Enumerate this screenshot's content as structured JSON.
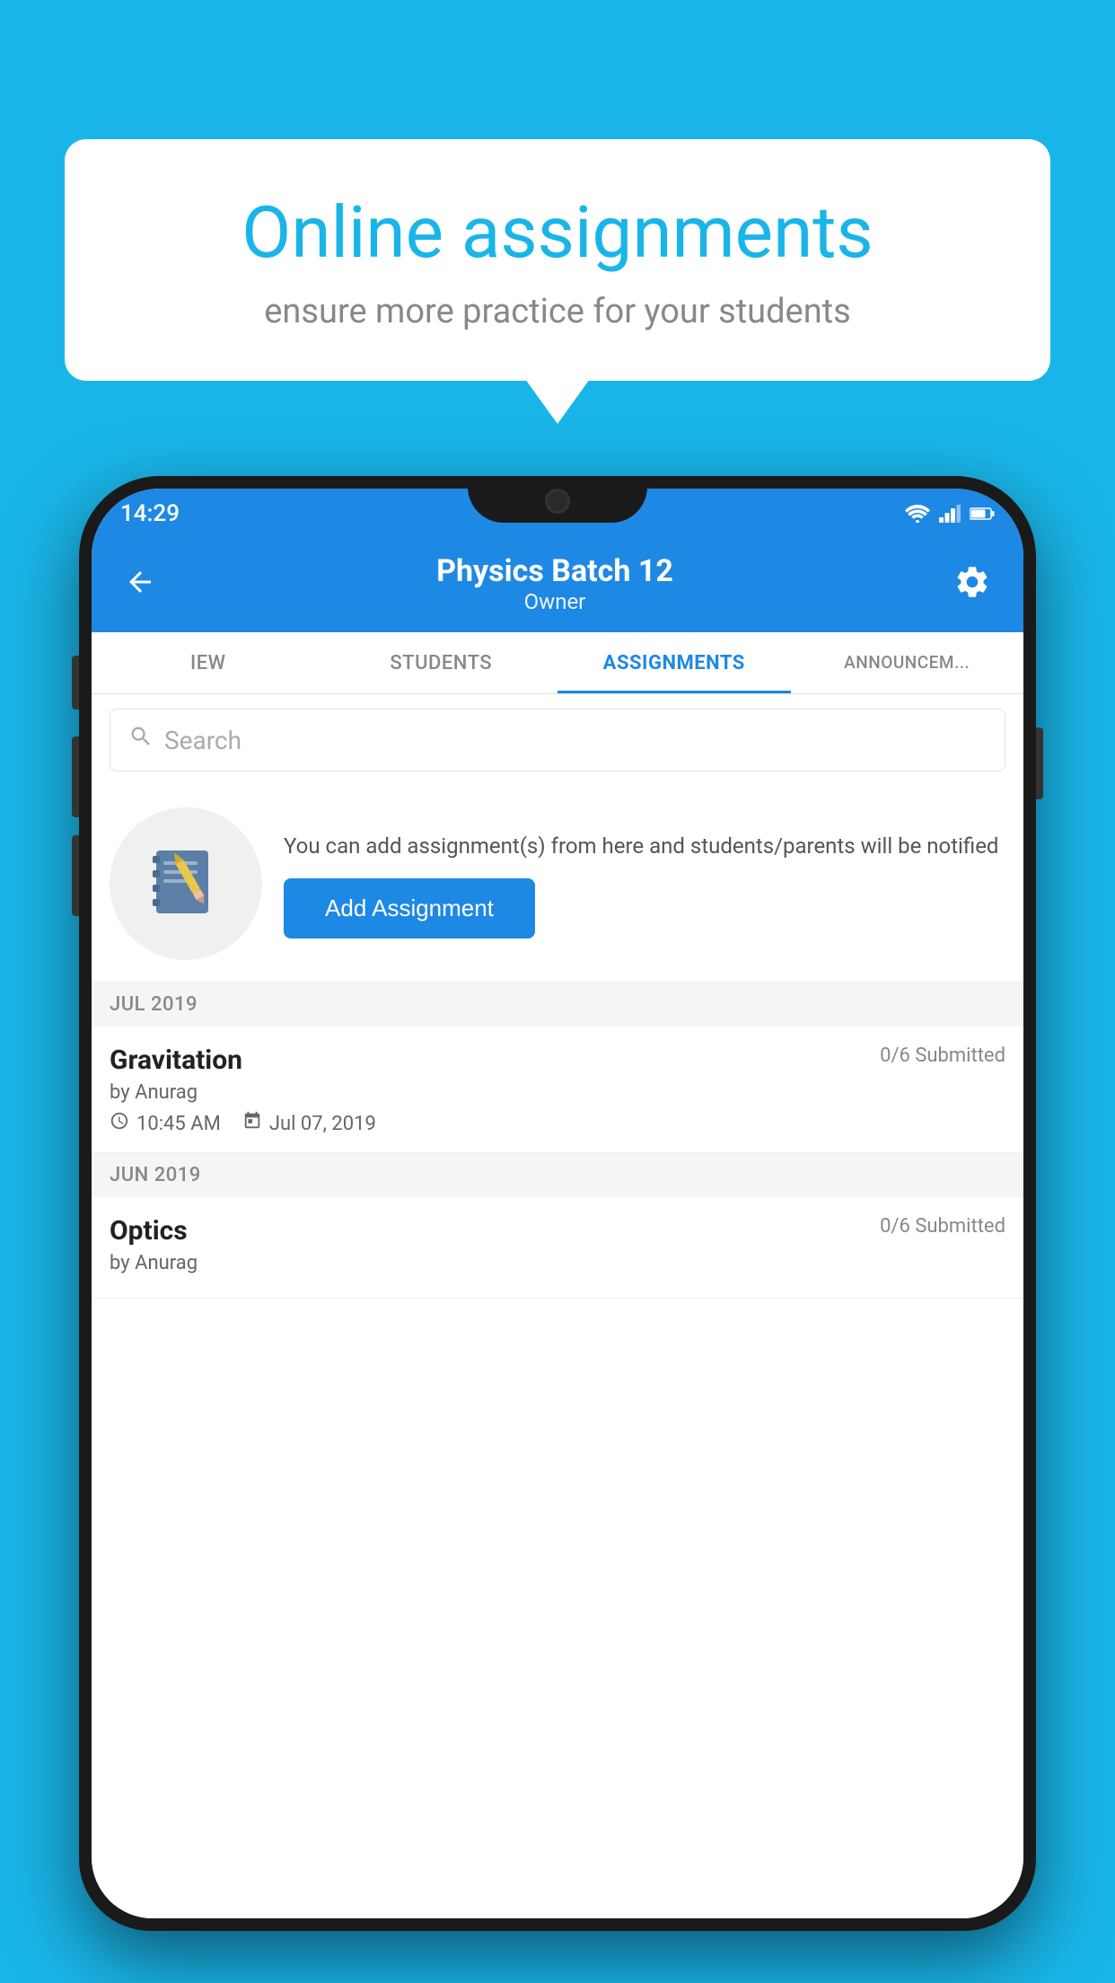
{
  "background_color": "#1ab5e8",
  "speech_bubble": {
    "title": "Online assignments",
    "subtitle": "ensure more practice for your students"
  },
  "phone": {
    "status_bar": {
      "time": "14:29",
      "icons": [
        "wifi",
        "signal",
        "battery"
      ]
    },
    "header": {
      "title": "Physics Batch 12",
      "subtitle": "Owner",
      "back_label": "←",
      "settings_label": "⚙"
    },
    "tabs": [
      {
        "label": "IEW",
        "active": false
      },
      {
        "label": "STUDENTS",
        "active": false
      },
      {
        "label": "ASSIGNMENTS",
        "active": true
      },
      {
        "label": "ANNOUNCEM...",
        "active": false
      }
    ],
    "search": {
      "placeholder": "Search"
    },
    "promo": {
      "text": "You can add assignment(s) from here and students/parents will be notified",
      "button_label": "Add Assignment"
    },
    "assignments": [
      {
        "month_group": "JUL 2019",
        "name": "Gravitation",
        "submitted": "0/6 Submitted",
        "by": "by Anurag",
        "time": "10:45 AM",
        "date": "Jul 07, 2019"
      },
      {
        "month_group": "JUN 2019",
        "name": "Optics",
        "submitted": "0/6 Submitted",
        "by": "by Anurag",
        "time": "",
        "date": ""
      }
    ]
  }
}
